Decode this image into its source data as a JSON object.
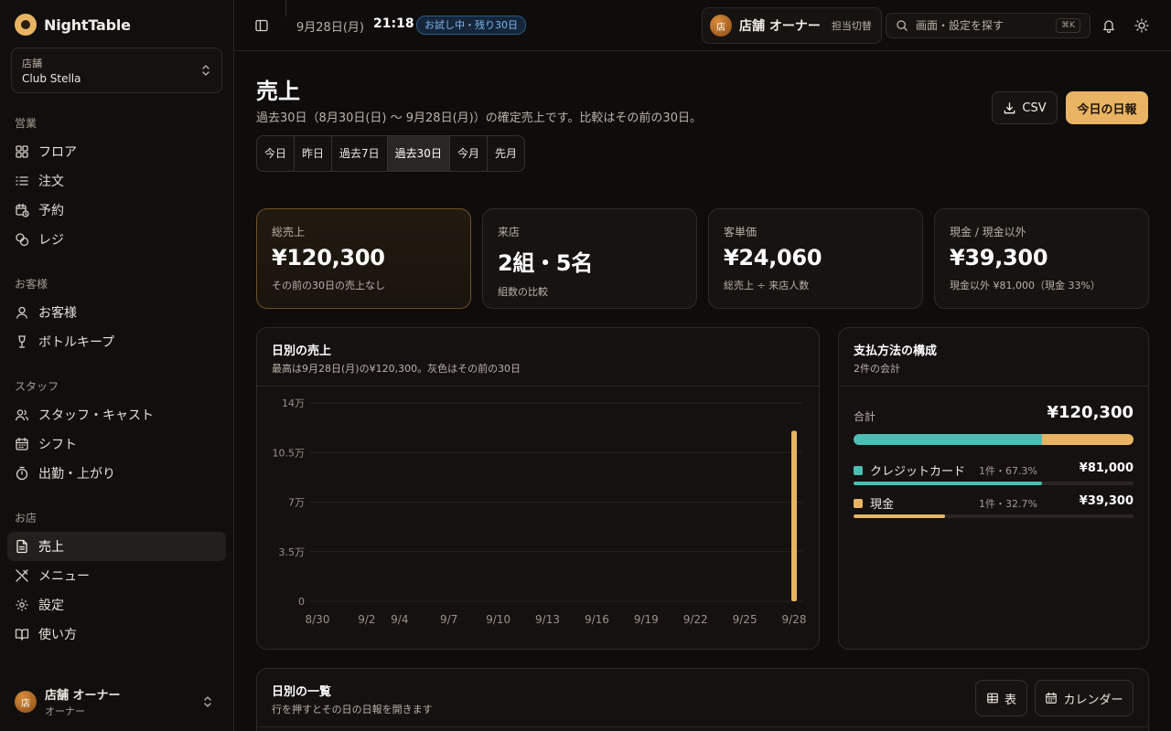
{
  "app": {
    "name": "NightTable"
  },
  "store": {
    "label": "店舗",
    "value": "Club Stella"
  },
  "nav": {
    "sections": [
      {
        "title": "営業",
        "items": [
          {
            "label": "フロア",
            "icon": "grid-icon"
          },
          {
            "label": "注文",
            "icon": "list-icon"
          },
          {
            "label": "予約",
            "icon": "calendar-clock-icon"
          },
          {
            "label": "レジ",
            "icon": "coins-icon"
          }
        ]
      },
      {
        "title": "お客様",
        "items": [
          {
            "label": "お客様",
            "icon": "user-icon"
          },
          {
            "label": "ボトルキープ",
            "icon": "bottle-icon"
          }
        ]
      },
      {
        "title": "スタッフ",
        "items": [
          {
            "label": "スタッフ・キャスト",
            "icon": "users-icon"
          },
          {
            "label": "シフト",
            "icon": "calendar-icon"
          },
          {
            "label": "出勤・上がり",
            "icon": "timer-icon"
          }
        ]
      },
      {
        "title": "お店",
        "items": [
          {
            "label": "売上",
            "icon": "file-text-icon",
            "active": true
          },
          {
            "label": "メニュー",
            "icon": "utensils-icon"
          },
          {
            "label": "設定",
            "icon": "gear-icon"
          },
          {
            "label": "使い方",
            "icon": "book-icon"
          }
        ]
      }
    ]
  },
  "user": {
    "name": "店舗 オーナー",
    "role": "オーナー",
    "avatar": "店"
  },
  "topbar": {
    "date": "9月28日(月)",
    "time": "21:18",
    "trial": "お試し中・残り30日",
    "owner_name": "店舗 オーナー",
    "switch_label": "担当切替",
    "search_placeholder": "画面・設定を探す",
    "shortcut": "⌘K"
  },
  "page": {
    "title": "売上",
    "subtitle": "過去30日（8月30日(日) 〜 9月28日(月)）の確定売上です。比較はその前の30日。",
    "csv_label": "CSV",
    "report_label": "今日の日報",
    "ranges": [
      "今日",
      "昨日",
      "過去7日",
      "過去30日",
      "今月",
      "先月"
    ],
    "active_range": "過去30日"
  },
  "kpis": [
    {
      "label": "総売上",
      "value": "¥120,300",
      "note": "その前の30日の売上なし"
    },
    {
      "label": "来店",
      "value": "2組・5名",
      "note": "組数の比較"
    },
    {
      "label": "客単価",
      "value": "¥24,060",
      "note": "総売上 ÷ 来店人数"
    },
    {
      "label": "現金 / 現金以外",
      "value": "¥39,300",
      "note": "現金以外 ¥81,000（現金 33%）"
    }
  ],
  "daily_chart": {
    "title": "日別の売上",
    "subtitle": "最高は9月28日(月)の¥120,300。灰色はその前の30日"
  },
  "chart_data": {
    "type": "bar",
    "title": "日別の売上",
    "y_ticks": [
      "0",
      "3.5万",
      "7万",
      "10.5万",
      "14万"
    ],
    "ylim": [
      0,
      140000
    ],
    "x_tick_labels": [
      "8/30",
      "9/2",
      "9/4",
      "9/7",
      "9/10",
      "9/13",
      "9/16",
      "9/19",
      "9/22",
      "9/25",
      "9/28"
    ],
    "series": [
      {
        "values": [
          {
            "x": "9/28",
            "y": 120300
          }
        ],
        "color": "#e8b463"
      }
    ],
    "grid": true
  },
  "payment": {
    "title": "支払方法の構成",
    "subtitle": "2件の会計",
    "total_label": "合計",
    "total_value": "¥120,300",
    "methods": [
      {
        "name": "クレジットカード",
        "meta": "1件・67.3%",
        "amount": "¥81,000",
        "share": 0.673,
        "color": "#4bbdb3"
      },
      {
        "name": "現金",
        "meta": "1件・32.7%",
        "amount": "¥39,300",
        "share": 0.327,
        "color": "#e8b463"
      }
    ]
  },
  "daily_list": {
    "title": "日別の一覧",
    "subtitle": "行を押すとその日の日報を開きます",
    "table_label": "表",
    "calendar_label": "カレンダー"
  }
}
